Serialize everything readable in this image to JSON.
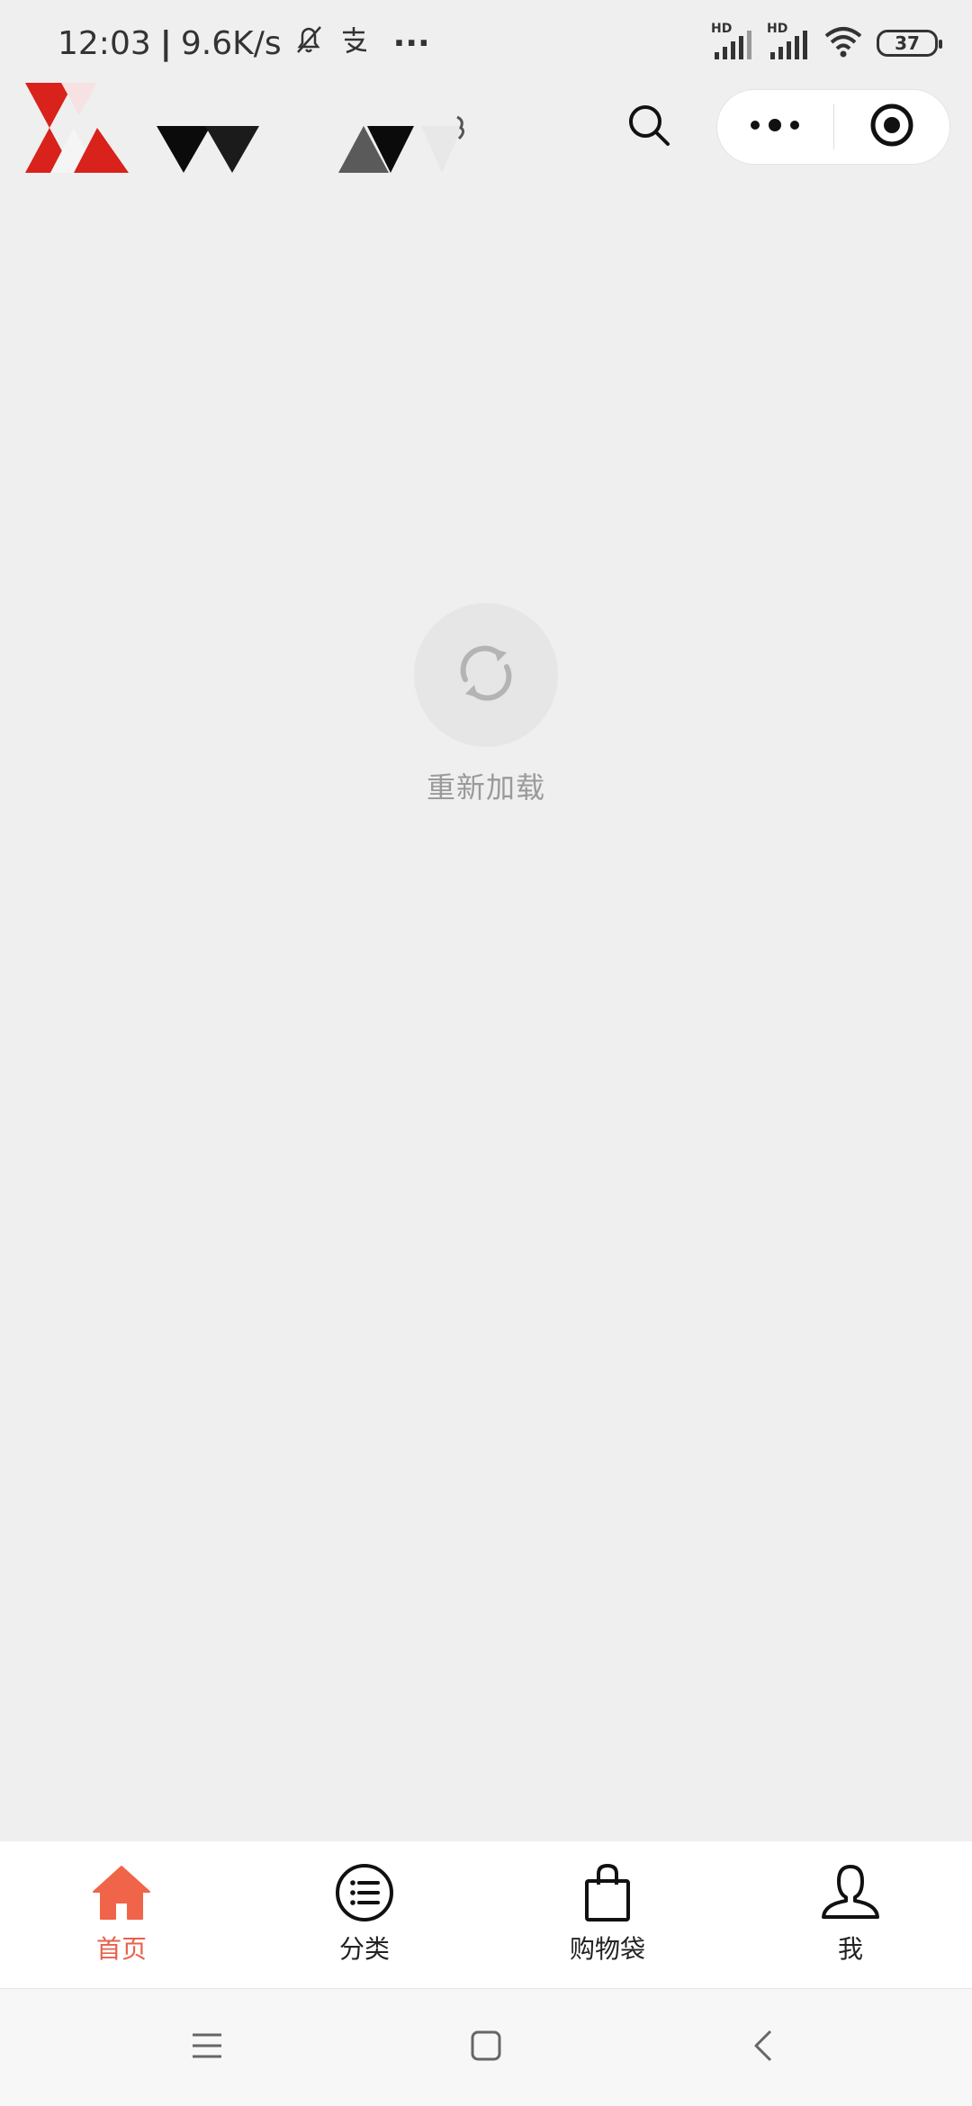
{
  "status_bar": {
    "time": "12:03",
    "separator": "|",
    "net_speed": "9.6K/s",
    "more_dots": "···",
    "signal_hd_1": "HD",
    "signal_hd_2": "HD",
    "battery": "37",
    "icons": [
      "bell-off-icon",
      "alipay-icon",
      "signal-icon",
      "signal-icon",
      "wifi-icon",
      "battery-icon"
    ]
  },
  "header": {
    "icons": [
      "logo",
      "search-icon",
      "more-dots-icon",
      "close-target-icon"
    ]
  },
  "reload": {
    "label": "重新加载",
    "icon": "refresh-icon"
  },
  "tabbar": {
    "accent_color": "#e8604c",
    "items": [
      {
        "label": "首页",
        "icon": "home-icon",
        "active": true
      },
      {
        "label": "分类",
        "icon": "category-list-icon",
        "active": false
      },
      {
        "label": "购物袋",
        "icon": "shopping-bag-icon",
        "active": false
      },
      {
        "label": "我",
        "icon": "user-icon",
        "active": false
      }
    ]
  },
  "navbar": {
    "icons": [
      "menu-icon",
      "home-square-icon",
      "back-icon"
    ]
  }
}
